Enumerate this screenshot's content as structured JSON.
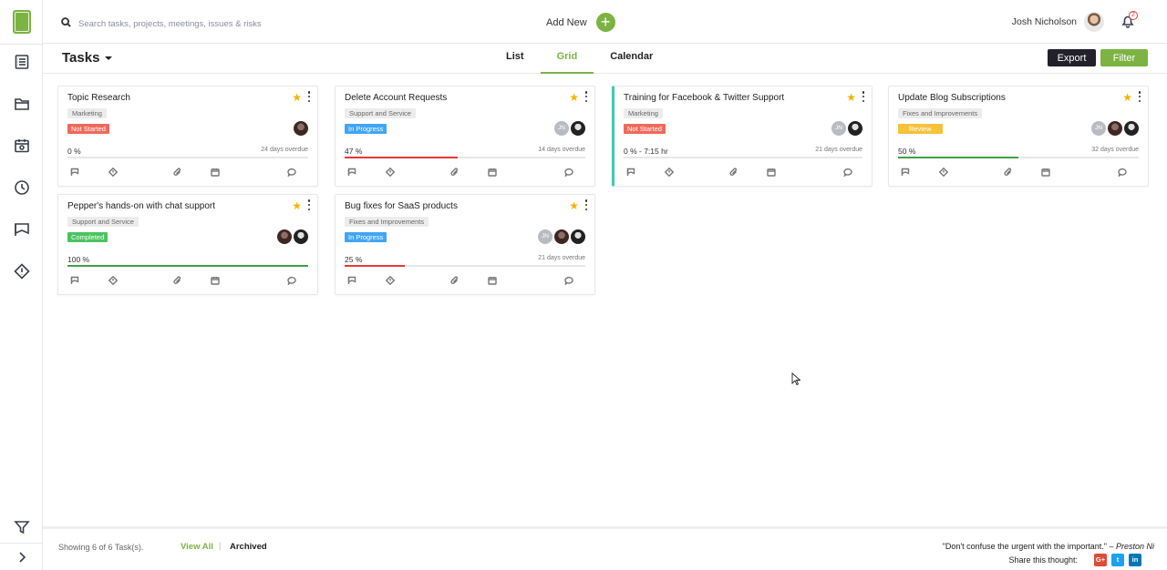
{
  "header": {
    "search_placeholder": "Search tasks, projects, meetings, issues & risks",
    "add_new_label": "Add New",
    "add_new_icon": "+",
    "user_name": "Josh Nicholson",
    "notification_count": "2"
  },
  "toolbar": {
    "title": "Tasks",
    "tabs": [
      {
        "label": "List",
        "active": false
      },
      {
        "label": "Grid",
        "active": true
      },
      {
        "label": "Calendar",
        "active": false
      }
    ],
    "export_label": "Export",
    "filter_label": "Filter"
  },
  "colors": {
    "brand_green": "#7cb342",
    "not_started": "#ee6a5a",
    "in_progress": "#42a5f5",
    "completed": "#4cc35f",
    "review": "#f6c23a",
    "progress_red": "#e53935",
    "progress_green": "#43a047",
    "accent_teal": "#3fc8b7"
  },
  "cards": [
    {
      "title": "Topic Research",
      "category": "Marketing",
      "status": "Not Started",
      "progress_label": "0 %",
      "progress": 0,
      "overdue": "24 days overdue",
      "avatars": [
        "photo-1"
      ]
    },
    {
      "title": "Delete Account Requests",
      "category": "Support and Service",
      "status": "In Progress",
      "progress_label": "47 %",
      "progress": 47,
      "overdue": "14 days overdue",
      "avatars": [
        "JN",
        "photo-2"
      ]
    },
    {
      "title": "Training for Facebook & Twitter Support",
      "category": "Marketing",
      "status": "Not Started",
      "progress_label": "0 % - 7:15 hr",
      "progress": 0,
      "overdue": "21 days overdue",
      "avatars": [
        "JN",
        "photo-2"
      ]
    },
    {
      "title": "Update Blog Subscriptions",
      "category": "Fixes and Improvements",
      "status": "Review",
      "progress_label": "50 %",
      "progress": 50,
      "overdue": "32 days overdue",
      "avatars": [
        "JN",
        "photo-1",
        "photo-2"
      ]
    },
    {
      "title": "Pepper's hands-on with chat support",
      "category": "Support and Service",
      "status": "Completed",
      "progress_label": "100 %",
      "progress": 100,
      "overdue": "",
      "avatars": [
        "photo-1",
        "photo-2"
      ]
    },
    {
      "title": "Bug fixes for SaaS products",
      "category": "Fixes and Improvements",
      "status": "In Progress",
      "progress_label": "25 %",
      "progress": 25,
      "overdue": "21 days overdue",
      "avatars": [
        "JN",
        "photo-1",
        "photo-2"
      ]
    }
  ],
  "footer": {
    "showing": "Showing 6 of 6 Task(s).",
    "view_all": "View All",
    "separator": "|",
    "archived": "Archived",
    "quote": "\"Don't confuse the urgent with the important.\"",
    "quote_author": "Preston Ni",
    "share_label": "Share this thought:",
    "social": [
      {
        "name": "google-plus",
        "label": "G+",
        "color": "#dd4b39"
      },
      {
        "name": "twitter",
        "label": "t",
        "color": "#1da1f2"
      },
      {
        "name": "linkedin",
        "label": "in",
        "color": "#0077b5"
      }
    ]
  },
  "sidebar": {
    "icons": [
      "tasks-icon",
      "folder-icon",
      "calendar-icon",
      "clock-icon",
      "flag-icon",
      "alert-icon",
      "filter-icon",
      "chevron-right-icon"
    ]
  }
}
